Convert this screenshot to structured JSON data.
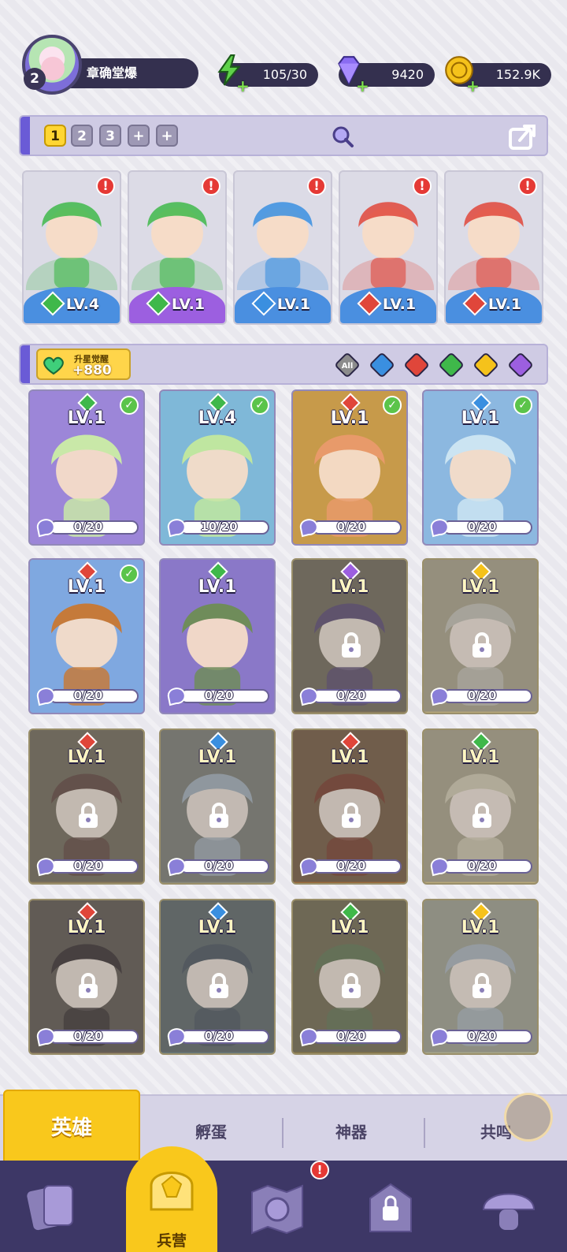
{
  "player": {
    "level": "2",
    "name": "章确堂爆"
  },
  "resources": [
    {
      "name": "energy",
      "value": "105/30",
      "color": "#5fd24a"
    },
    {
      "name": "gems",
      "value": "9420",
      "color": "#8a6cf2"
    },
    {
      "name": "gold",
      "value": "152.9K",
      "color": "#f5c21b"
    }
  ],
  "team_tabs": [
    "1",
    "2",
    "3",
    "+",
    "+"
  ],
  "team_active_tab": "1",
  "team": [
    {
      "level": "LV.4",
      "element": "wind",
      "el_color": "#3fb84a",
      "bar_color": "#4a8fe0",
      "alert": "!"
    },
    {
      "level": "LV.1",
      "element": "wind",
      "el_color": "#3fb84a",
      "bar_color": "#9c5fe0",
      "alert": "!"
    },
    {
      "level": "LV.1",
      "element": "water",
      "el_color": "#3a8fe0",
      "bar_color": "#4a8fe0",
      "alert": "!"
    },
    {
      "level": "LV.1",
      "element": "fire",
      "el_color": "#e0463a",
      "bar_color": "#4a8fe0",
      "alert": "!"
    },
    {
      "level": "LV.1",
      "element": "fire",
      "el_color": "#e0463a",
      "bar_color": "#4a8fe0",
      "alert": "!"
    }
  ],
  "awaken": {
    "title": "升星觉醒",
    "value": "+880"
  },
  "filters": [
    {
      "name": "all",
      "label": "All",
      "color": "#8c8c8c"
    },
    {
      "name": "water",
      "label": "",
      "color": "#3a8fe0"
    },
    {
      "name": "fire",
      "label": "",
      "color": "#e0463a"
    },
    {
      "name": "wind",
      "label": "",
      "color": "#3fb84a"
    },
    {
      "name": "light",
      "label": "",
      "color": "#f5c21b"
    },
    {
      "name": "dark",
      "label": "",
      "color": "#9c5fe0"
    }
  ],
  "heroes": [
    {
      "level": "LV.1",
      "element": "wind",
      "shards": "0/20",
      "checked": true,
      "locked": false,
      "bg": "#9c86d8",
      "art": "#c9e8a8"
    },
    {
      "level": "LV.4",
      "element": "wind",
      "shards": "10/20",
      "checked": true,
      "locked": false,
      "bg": "#7fb8d8",
      "art": "#bfe6a0"
    },
    {
      "level": "LV.1",
      "element": "fire",
      "shards": "0/20",
      "checked": true,
      "locked": false,
      "bg": "#c79a4a",
      "art": "#e89a6a"
    },
    {
      "level": "LV.1",
      "element": "water",
      "shards": "0/20",
      "checked": true,
      "locked": false,
      "bg": "#8cb8e0",
      "art": "#cbe4f2"
    },
    {
      "level": "LV.1",
      "element": "fire",
      "shards": "0/20",
      "checked": true,
      "locked": false,
      "bg": "#7fa8e0",
      "art": "#c57a3a"
    },
    {
      "level": "LV.1",
      "element": "wind",
      "shards": "0/20",
      "checked": false,
      "locked": false,
      "bg": "#8a78c8",
      "art": "#6f8c5a"
    },
    {
      "level": "LV.1",
      "element": "dark",
      "shards": "0/20",
      "checked": false,
      "locked": true,
      "bg": "#8a7a5a",
      "art": "#7a5c9c"
    },
    {
      "level": "LV.1",
      "element": "light",
      "shards": "0/20",
      "checked": false,
      "locked": true,
      "bg": "#b8a87a",
      "art": "#c8c0a8"
    },
    {
      "level": "LV.1",
      "element": "fire",
      "shards": "0/20",
      "checked": false,
      "locked": true,
      "bg": "#8a7a5a",
      "art": "#8a5a4a"
    },
    {
      "level": "LV.1",
      "element": "water",
      "shards": "0/20",
      "checked": false,
      "locked": true,
      "bg": "#8a8a7a",
      "art": "#9fb4c4"
    },
    {
      "level": "LV.1",
      "element": "fire",
      "shards": "0/20",
      "checked": false,
      "locked": true,
      "bg": "#9a6a3a",
      "art": "#b84a2a"
    },
    {
      "level": "LV.1",
      "element": "wind",
      "shards": "0/20",
      "checked": false,
      "locked": true,
      "bg": "#b8a87a",
      "art": "#d8c89a"
    },
    {
      "level": "LV.1",
      "element": "fire",
      "shards": "0/20",
      "checked": false,
      "locked": true,
      "bg": "#7a6a5a",
      "art": "#5a4a4a"
    },
    {
      "level": "LV.1",
      "element": "water",
      "shards": "0/20",
      "checked": false,
      "locked": true,
      "bg": "#6a7a7a",
      "art": "#5a6a7a"
    },
    {
      "level": "LV.1",
      "element": "wind",
      "shards": "0/20",
      "checked": false,
      "locked": true,
      "bg": "#8a7a4a",
      "art": "#6a8a4a"
    },
    {
      "level": "LV.1",
      "element": "light",
      "shards": "0/20",
      "checked": false,
      "locked": true,
      "bg": "#a8a88a",
      "art": "#a8b8c4"
    }
  ],
  "element_colors": {
    "wind": "#3fb84a",
    "water": "#3a8fe0",
    "fire": "#e0463a",
    "dark": "#9c5fe0",
    "light": "#f5c21b"
  },
  "subtabs": {
    "active": "英雄",
    "items": [
      "孵蛋",
      "神器",
      "共鸣"
    ]
  },
  "bottom_nav": {
    "items": [
      {
        "name": "cards",
        "icon": "cards-icon"
      },
      {
        "name": "barracks",
        "icon": "barracks-icon",
        "label": "兵营",
        "active": true
      },
      {
        "name": "map",
        "icon": "map-icon",
        "alert": "!"
      },
      {
        "name": "shop",
        "icon": "locked-shop-icon"
      },
      {
        "name": "guild",
        "icon": "mushroom-icon"
      }
    ]
  }
}
